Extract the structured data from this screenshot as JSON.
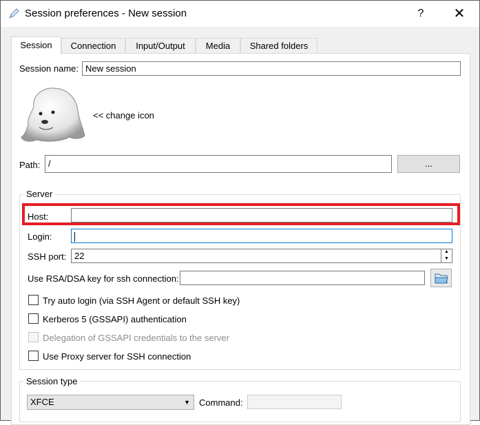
{
  "window": {
    "title": "Session preferences - New session",
    "help_label": "?",
    "close_label": "✕"
  },
  "tabs": [
    {
      "label": "Session"
    },
    {
      "label": "Connection"
    },
    {
      "label": "Input/Output"
    },
    {
      "label": "Media"
    },
    {
      "label": "Shared folders"
    }
  ],
  "session": {
    "name_label": "Session name:",
    "name_value": "New session",
    "change_icon_label": "<< change icon",
    "path_label": "Path:",
    "path_value": "/",
    "browse_label": "..."
  },
  "server": {
    "group_title": "Server",
    "host_label": "Host:",
    "host_value": "",
    "login_label": "Login:",
    "login_value": "",
    "ssh_port_label": "SSH port:",
    "ssh_port_value": "22",
    "rsa_label": "Use RSA/DSA key for ssh connection:",
    "rsa_value": "",
    "checkboxes": [
      {
        "label": "Try auto login (via SSH Agent or default SSH key)",
        "checked": false,
        "enabled": true
      },
      {
        "label": "Kerberos 5 (GSSAPI) authentication",
        "checked": false,
        "enabled": true
      },
      {
        "label": "Delegation of GSSAPI credentials to the server",
        "checked": false,
        "enabled": false
      },
      {
        "label": "Use Proxy server for SSH connection",
        "checked": false,
        "enabled": true
      }
    ]
  },
  "session_type": {
    "group_title": "Session type",
    "selected": "XFCE",
    "command_label": "Command:",
    "command_value": ""
  },
  "colors": {
    "highlight": "#e31f24",
    "focus": "#0078d7"
  }
}
